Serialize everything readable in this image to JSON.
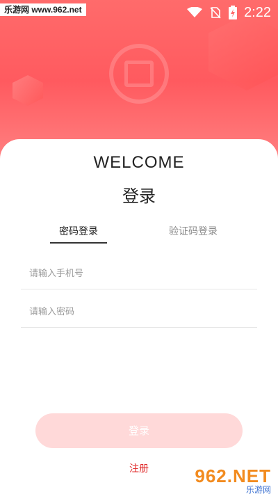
{
  "status_bar": {
    "site_label": "乐游网 www.962.net",
    "time": "2:22",
    "icons": [
      "wifi-icon",
      "no-sim-icon",
      "battery-icon"
    ]
  },
  "header": {
    "logo_icon": "emblem-logo-icon",
    "accent_color": "#ff5a5f"
  },
  "card": {
    "welcome": "WELCOME",
    "title": "登录"
  },
  "tabs": [
    {
      "label": "密码登录",
      "active": true
    },
    {
      "label": "验证码登录",
      "active": false
    }
  ],
  "form": {
    "phone_placeholder": "请输入手机号",
    "password_placeholder": "请输入密码"
  },
  "actions": {
    "login_label": "登录",
    "register_label": "注册",
    "register_color": "#e02a2a"
  },
  "watermark": {
    "brand": "962.NET",
    "sub": "乐游网"
  }
}
